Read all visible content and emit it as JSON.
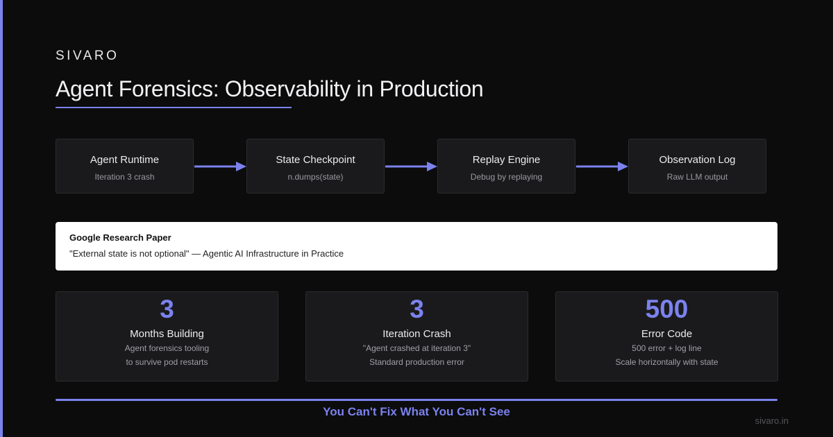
{
  "brand": "SIVARO",
  "title": "Agent Forensics: Observability in Production",
  "accent_color": "#7b82ee",
  "flow": [
    {
      "title": "Agent Runtime",
      "subtitle": "Iteration 3 crash"
    },
    {
      "title": "State Checkpoint",
      "subtitle": "n.dumps(state)"
    },
    {
      "title": "Replay Engine",
      "subtitle": "Debug by replaying"
    },
    {
      "title": "Observation Log",
      "subtitle": "Raw LLM output"
    }
  ],
  "quote": {
    "title": "Google Research Paper",
    "text": "\"External state is not optional\" — Agentic AI Infrastructure in Practice"
  },
  "stats": [
    {
      "value": "3",
      "label": "Months Building",
      "line1": "Agent forensics tooling",
      "line2": "to survive pod restarts"
    },
    {
      "value": "3",
      "label": "Iteration Crash",
      "line1": "\"Agent crashed at iteration 3\"",
      "line2": "Standard production error"
    },
    {
      "value": "500",
      "label": "Error Code",
      "line1": "500 error + log line",
      "line2": "Scale horizontally with state"
    }
  ],
  "tagline": "You Can't Fix What You Can't See",
  "domain": "sivaro.in"
}
